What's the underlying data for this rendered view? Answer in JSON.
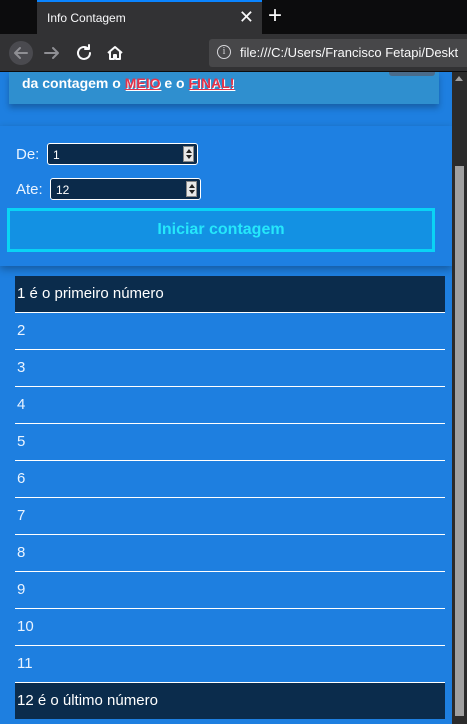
{
  "browser": {
    "tab_title": "Info Contagem",
    "url": "file:///C:/Users/Francisco Fetapi/Deskt"
  },
  "intro": {
    "prefix": "da contagem o ",
    "middle": "MEIO",
    "joiner": " e o ",
    "final": "FINAL!"
  },
  "form": {
    "from_label": "De:",
    "from_value": "1",
    "to_label": "Ate:",
    "to_value": "12",
    "start_label": "Iniciar contagem"
  },
  "results": [
    {
      "text": "1 é o primeiro número",
      "highlight": true
    },
    {
      "text": "2",
      "highlight": false
    },
    {
      "text": "3",
      "highlight": false
    },
    {
      "text": "4",
      "highlight": false
    },
    {
      "text": "5",
      "highlight": false
    },
    {
      "text": "6",
      "highlight": false
    },
    {
      "text": "7",
      "highlight": false
    },
    {
      "text": "8",
      "highlight": false
    },
    {
      "text": "9",
      "highlight": false
    },
    {
      "text": "10",
      "highlight": false
    },
    {
      "text": "11",
      "highlight": false
    },
    {
      "text": "12 é o último número",
      "highlight": true
    }
  ],
  "icons": {
    "back": "arrow-left-icon",
    "forward": "arrow-right-icon",
    "reload": "reload-icon",
    "home": "home-icon",
    "info": "info-icon",
    "close": "close-icon",
    "new_tab": "plus-icon"
  },
  "colors": {
    "page_bg": "#1e7fe0",
    "highlight_row": "#0b2c4c",
    "button_border": "#0ad3f5",
    "button_text": "#25e7fb",
    "intro_accent": "#e3344b"
  }
}
